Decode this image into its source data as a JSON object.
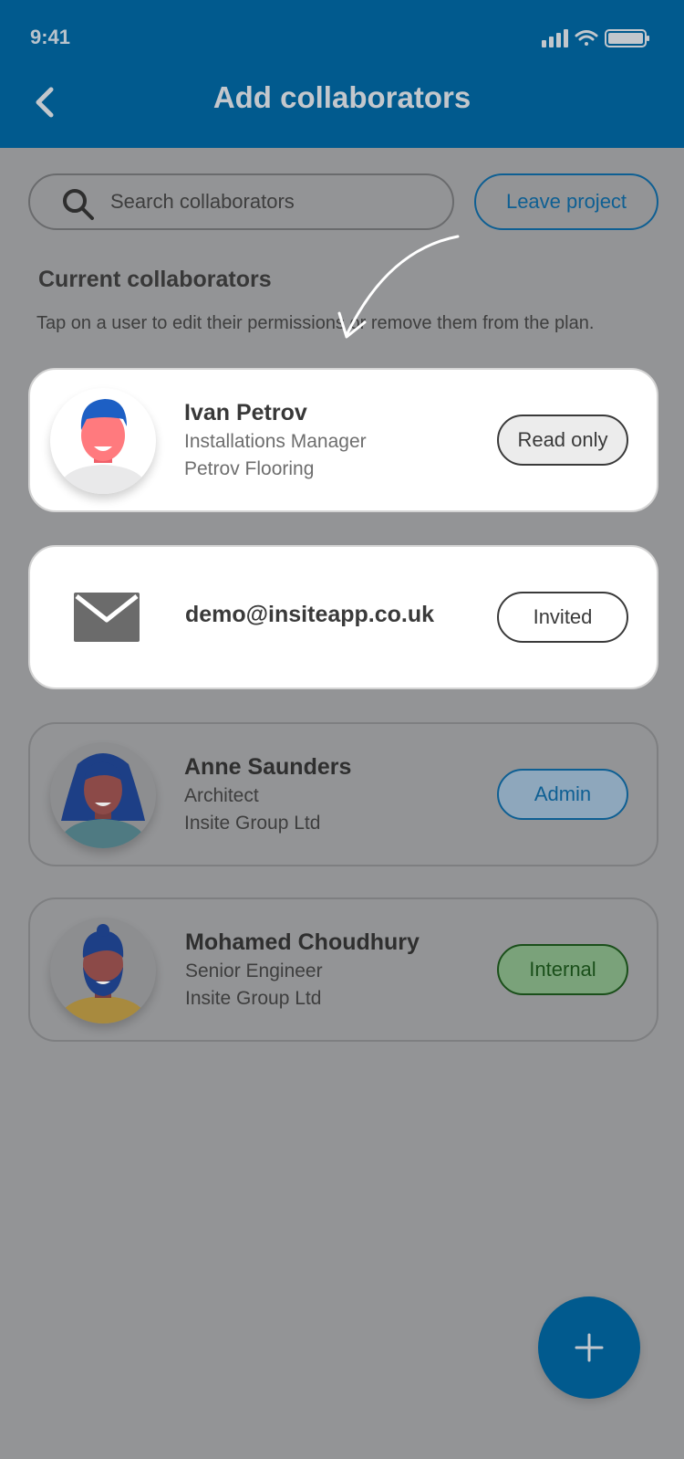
{
  "status_bar": {
    "time": "9:41"
  },
  "header": {
    "title": "Add collaborators"
  },
  "search": {
    "placeholder": "Search collaborators"
  },
  "actions": {
    "leave_project": "Leave project"
  },
  "section": {
    "title": "Current collaborators",
    "description": "Tap on a user to edit their permissions or remove them from the plan."
  },
  "collaborators": [
    {
      "name": "Ivan Petrov",
      "role_title": "Installations Manager",
      "company": "Petrov Flooring",
      "permission": "Read only"
    },
    {
      "email": "demo@insiteapp.co.uk",
      "permission": "Invited"
    },
    {
      "name": "Anne Saunders",
      "role_title": "Architect",
      "company": "Insite Group Ltd",
      "permission": "Admin"
    },
    {
      "name": "Mohamed Choudhury",
      "role_title": "Senior Engineer",
      "company": "Insite Group Ltd",
      "permission": "Internal"
    }
  ],
  "icons": [
    "back-icon",
    "search-icon",
    "email-icon",
    "plus-icon",
    "signal-icon",
    "wifi-icon",
    "battery-icon"
  ],
  "colors": {
    "primary": "#015a8e",
    "overlay": "#939496",
    "admin": "#0e5f93",
    "internal": "#1a4f1a"
  }
}
